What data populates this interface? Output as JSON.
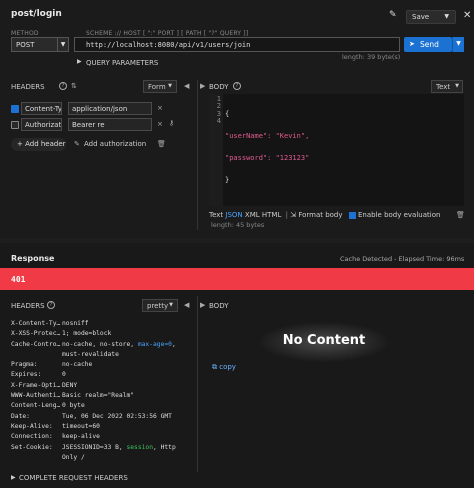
{
  "request": {
    "title": "post/login",
    "save_label": "Save",
    "method_label": "METHOD",
    "scheme_hint": "SCHEME :// HOST [ \":\" PORT ] [ PATH [ \"?\" QUERY ]]",
    "method": "POST",
    "url": "http://localhost:8080/api/v1/users/join",
    "send_label": "Send",
    "query_params_label": "QUERY PARAMETERS",
    "url_length": "length: 39 byte(s)",
    "headers_label": "HEADERS",
    "form_label": "Form",
    "headers": [
      {
        "key": "Content-Typ",
        "value": "application/json",
        "checked": true
      },
      {
        "key": "Authorizatio",
        "value": "Bearer re",
        "checked": false
      }
    ],
    "add_header": "Add header",
    "add_auth": "Add authorization",
    "body_label": "BODY",
    "body_type": "Text",
    "body_lines": [
      "{",
      "\"userName\": \"Kevin\",",
      "\"password\": \"123123\"",
      "}"
    ],
    "line_numbers": [
      "1",
      "2",
      "3",
      "4"
    ],
    "format_bar": {
      "text": "Text",
      "json": "JSON",
      "xml": "XML",
      "html": "HTML",
      "format_body": "Format body",
      "enable_eval": "Enable body evaluation"
    },
    "body_length": "length: 45 bytes"
  },
  "response": {
    "title": "Response",
    "cache_info": "Cache Detected - Elapsed Time: 96ms",
    "status_code": "401",
    "headers_label": "HEADERS",
    "pretty_label": "pretty",
    "body_label": "BODY",
    "no_content": "No Content",
    "copy_label": "copy",
    "headers": [
      {
        "key": "X-Content-Ty…",
        "value": "nosniff"
      },
      {
        "key": "X-XSS-Protec…",
        "value": "1; mode=block"
      },
      {
        "key": "Cache-Contro…",
        "value_parts": [
          "no-cache, no-store, ",
          "max-age=0",
          ", must-revalidate"
        ]
      },
      {
        "key": "Pragma:",
        "value": "no-cache"
      },
      {
        "key": "Expires:",
        "value": "0"
      },
      {
        "key": "X-Frame-Opti…",
        "value": "DENY"
      },
      {
        "key": "WWW-Authenti…",
        "value": "Basic realm=\"Realm\""
      },
      {
        "key": "Content-Leng…",
        "value": "0 byte"
      },
      {
        "key": "Date:",
        "value": "Tue, 06 Dec 2022 02:53:56 GMT"
      },
      {
        "key": "Keep-Alive:",
        "value": "timeout=60"
      },
      {
        "key": "Connection:",
        "value": "keep-alive"
      },
      {
        "key": "Set-Cookie:",
        "value_parts": [
          "JSESSIONID=33 B, ",
          "session",
          ", Http Only /"
        ]
      }
    ],
    "complete_headers": "COMPLETE REQUEST HEADERS"
  },
  "colors": {
    "send": "#1b72d2",
    "status_error": "#f03a46",
    "link": "#4aa3ff"
  }
}
